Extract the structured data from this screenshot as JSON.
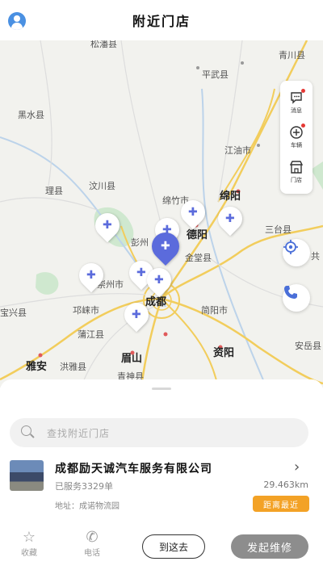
{
  "header": {
    "title": "附近门店"
  },
  "map": {
    "labels": {
      "songpan": "松潘县",
      "qingchuan": "青川县",
      "pingwu": "平武县",
      "heishui": "黑水县",
      "jiangyou": "江油市",
      "wenchuan": "汶川县",
      "li": "理县",
      "mianzhu": "绵竹市",
      "mianyang": "绵阳",
      "deyang": "德阳",
      "santai": "三台县",
      "pengzhou": "彭州",
      "jintang": "金堂县",
      "chongzhou": "崇州市",
      "chengdu": "成都",
      "baoxing": "宝兴县",
      "qionglai": "邛崃市",
      "jianyang": "简阳市",
      "pujiang": "蒲江县",
      "yaan": "雅安",
      "hongya": "洪雅县",
      "meishan": "眉山",
      "ziyang": "资阳",
      "anyue": "安岳县",
      "qingshen": "青神县",
      "gong": "共"
    }
  },
  "toolbar": {
    "message": "消息",
    "vehicle": "车辆",
    "store": "门店"
  },
  "sheet": {
    "search_placeholder": "查找附近门店",
    "store": {
      "name": "成都励天诚汽车服务有限公司",
      "served": "已服务3329单",
      "address": "地址：成诺物流园",
      "distance": "29.463km",
      "badge": "距离最近"
    },
    "actions": {
      "favorite": "收藏",
      "phone": "电话",
      "go_here": "到这去",
      "start_repair": "发起维修"
    }
  },
  "colors": {
    "accent": "#5b6bdc",
    "badge": "#f3a226",
    "repair_button": "#8d8d8d",
    "avatar": "#4a90e2"
  }
}
